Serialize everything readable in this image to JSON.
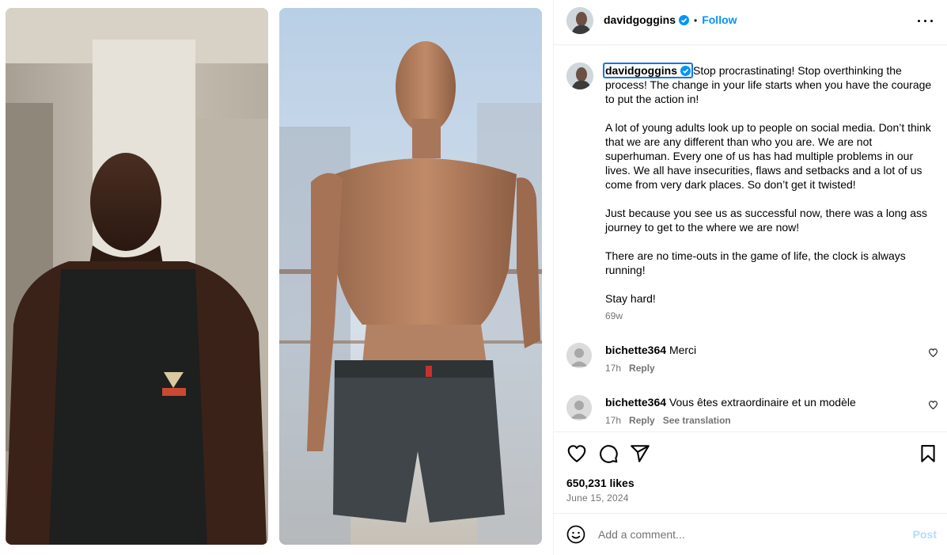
{
  "post": {
    "username": "davidgoggins",
    "verified": true,
    "follow_label": "Follow",
    "dot": "•"
  },
  "caption": {
    "username": "davidgoggins",
    "paragraphs": [
      "Stop procrastinating! Stop overthinking the process! The change in your life starts when you have the courage to put the action in!",
      "A lot of young adults look up to people on social media. Don’t think that we are any different than who you are. We are not superhuman. Every one of us has had multiple problems in our lives. We all have insecurities, flaws and setbacks and a lot of us come from very dark places. So don’t get it twisted!",
      "Just because you see us as successful now, there was a long ass journey to get to the where we are now!",
      "There are no time-outs in the game of life, the clock is always running!",
      "Stay hard!"
    ],
    "time": "69w"
  },
  "comments": [
    {
      "username": "bichette364",
      "text": "Merci",
      "time": "17h",
      "reply_label": "Reply",
      "translation_label": ""
    },
    {
      "username": "bichette364",
      "text": "Vous êtes extraordinaire et un modèle",
      "time": "17h",
      "reply_label": "Reply",
      "translation_label": "See translation"
    }
  ],
  "stats": {
    "likes": "650,231 likes",
    "date": "June 15, 2024"
  },
  "add_comment": {
    "placeholder": "Add a comment...",
    "post_label": "Post"
  },
  "colors": {
    "accent": "#0095f6",
    "verified": "#0095f6",
    "secondary_text": "#737373",
    "post_disabled": "#b3dbff"
  },
  "icons": {
    "like": "heart-icon",
    "comment": "comment-bubble-icon",
    "share": "paper-plane-icon",
    "save": "bookmark-icon",
    "more": "more-options-icon",
    "emoji": "emoji-icon"
  }
}
